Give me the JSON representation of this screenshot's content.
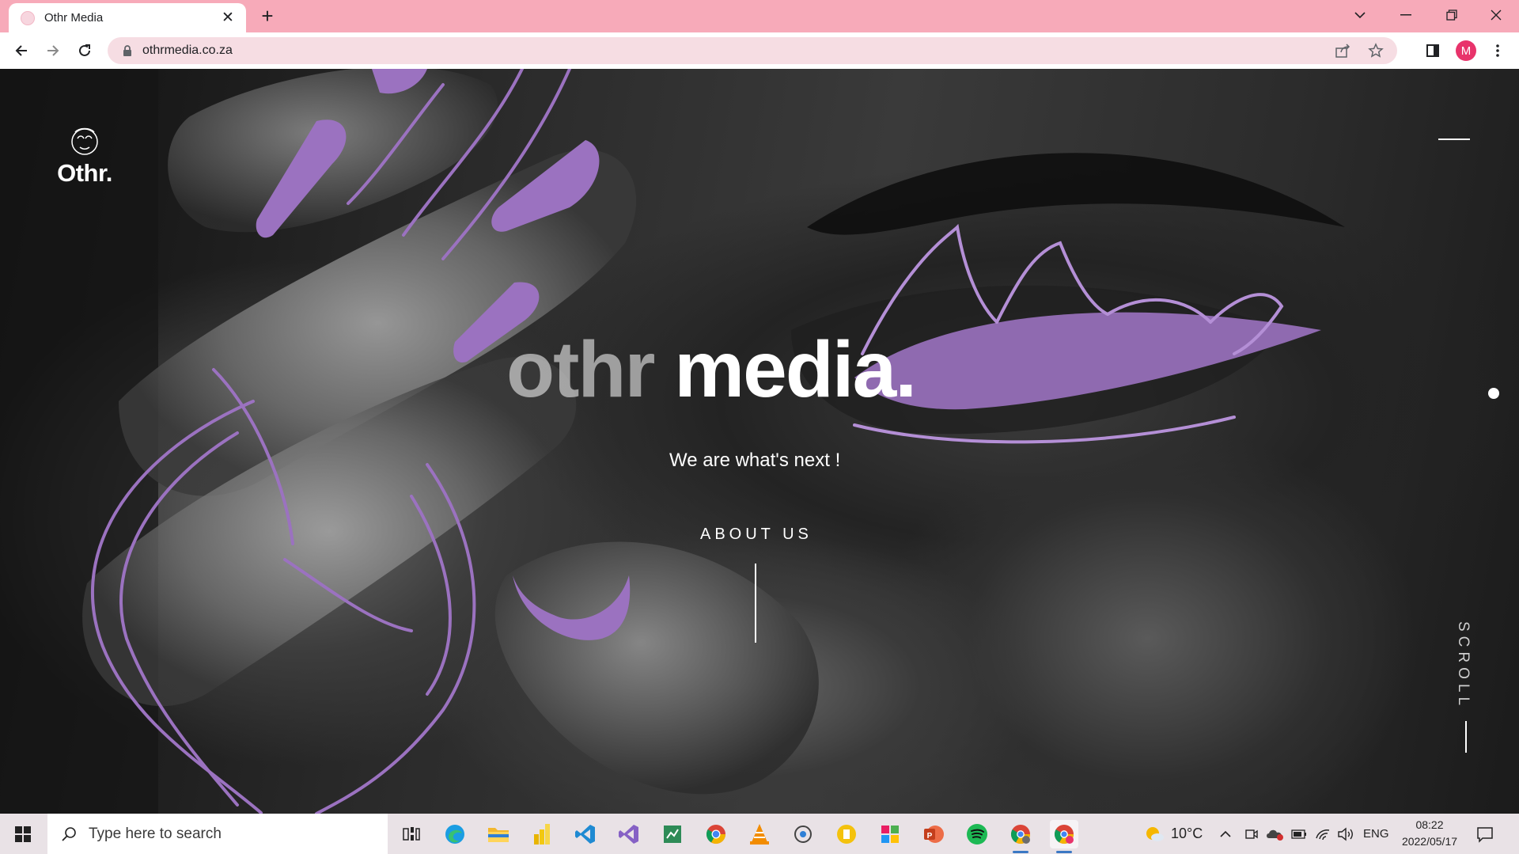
{
  "browser": {
    "tab_title": "Othr Media",
    "url": "othrmedia.co.za",
    "profile_initial": "M"
  },
  "site": {
    "logo_text": "Othr.",
    "headline_word1": "othr",
    "headline_word2": "media.",
    "tagline": "We are what's next !",
    "about_link": "ABOUT US",
    "scroll_label": "SCROLL",
    "accent_color": "#9b72c0"
  },
  "taskbar": {
    "search_placeholder": "Type here to search",
    "weather": "10°C",
    "language": "ENG",
    "time": "08:22",
    "date": "2022/05/17",
    "apps": [
      "task-view",
      "edge",
      "file-explorer",
      "power-bi",
      "vs-code",
      "visual-studio",
      "excel-like",
      "chrome",
      "vlc",
      "cortana",
      "keep",
      "photos",
      "powerpoint",
      "spotify",
      "chrome-profile",
      "chrome-active"
    ]
  }
}
